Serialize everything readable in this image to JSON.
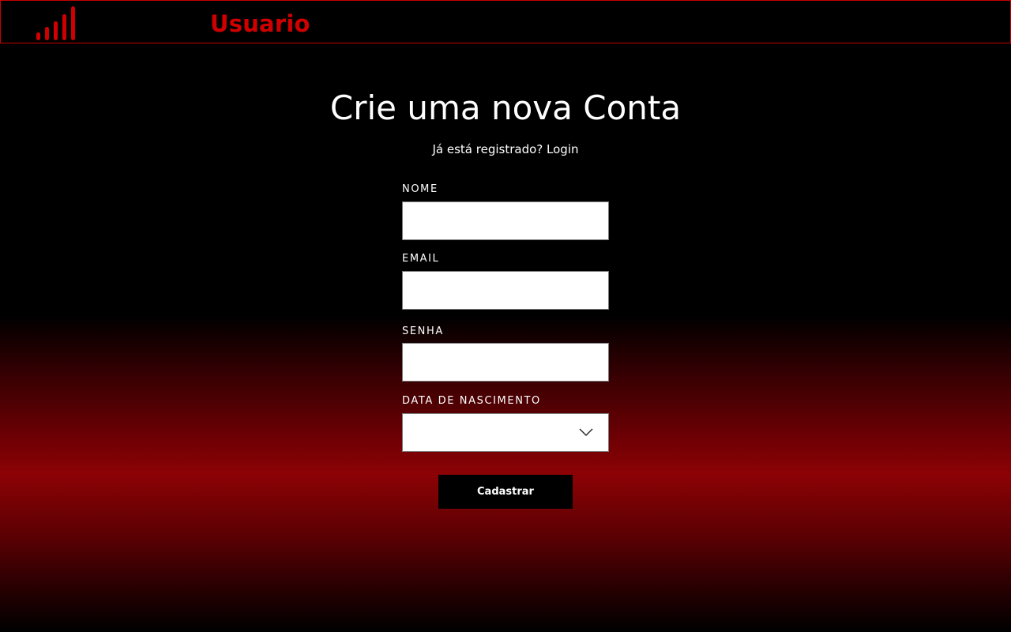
{
  "header": {
    "brand": "Usuario",
    "logo_icon": "signal-bars-icon",
    "accent_color": "#d10000",
    "border_color": "#c80000"
  },
  "form": {
    "title": "Crie uma nova Conta",
    "subtitle_prefix": "Já está registrado?",
    "login_link": "Login",
    "fields": {
      "name_label": "NOME",
      "name_value": "",
      "email_label": "EMAIL",
      "email_value": "",
      "password_label": "SENHA",
      "password_value": "",
      "birthdate_label": "DATA DE NASCIMENTO",
      "birthdate_value": "",
      "dropdown_icon": "chevron-down-icon"
    },
    "submit_label": "Cadastrar"
  },
  "colors": {
    "background_top": "#000000",
    "gradient_red": "#8c0205",
    "field_background": "#ffffff",
    "button_background": "#000000",
    "text": "#ffffff"
  }
}
